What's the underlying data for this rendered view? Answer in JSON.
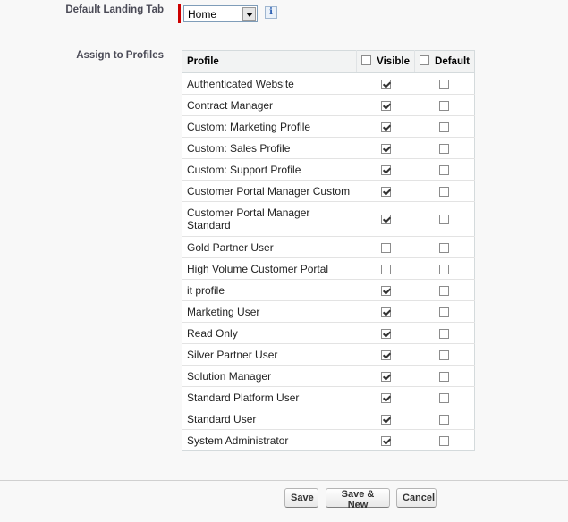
{
  "landing": {
    "label": "Default Landing Tab",
    "selected": "Home",
    "info_icon": "i"
  },
  "profiles": {
    "label": "Assign to Profiles",
    "columns": {
      "profile": "Profile",
      "visible": "Visible",
      "default": "Default"
    },
    "header_visible_checked": false,
    "header_default_checked": false,
    "rows": [
      {
        "name": "Authenticated Website",
        "visible": true,
        "default": false
      },
      {
        "name": "Contract Manager",
        "visible": true,
        "default": false
      },
      {
        "name": "Custom: Marketing Profile",
        "visible": true,
        "default": false
      },
      {
        "name": "Custom: Sales Profile",
        "visible": true,
        "default": false
      },
      {
        "name": "Custom: Support Profile",
        "visible": true,
        "default": false
      },
      {
        "name": "Customer Portal Manager Custom",
        "visible": true,
        "default": false
      },
      {
        "name": "Customer Portal Manager Standard",
        "visible": true,
        "default": false,
        "tall": true
      },
      {
        "name": "Gold Partner User",
        "visible": false,
        "default": false
      },
      {
        "name": "High Volume Customer Portal",
        "visible": false,
        "default": false
      },
      {
        "name": "it profile",
        "visible": true,
        "default": false
      },
      {
        "name": "Marketing User",
        "visible": true,
        "default": false
      },
      {
        "name": "Read Only",
        "visible": true,
        "default": false
      },
      {
        "name": "Silver Partner User",
        "visible": true,
        "default": false
      },
      {
        "name": "Solution Manager",
        "visible": true,
        "default": false
      },
      {
        "name": "Standard Platform User",
        "visible": true,
        "default": false
      },
      {
        "name": "Standard User",
        "visible": true,
        "default": false
      },
      {
        "name": "System Administrator",
        "visible": true,
        "default": false
      }
    ]
  },
  "buttons": {
    "save": "Save",
    "save_new": "Save & New",
    "cancel": "Cancel"
  }
}
